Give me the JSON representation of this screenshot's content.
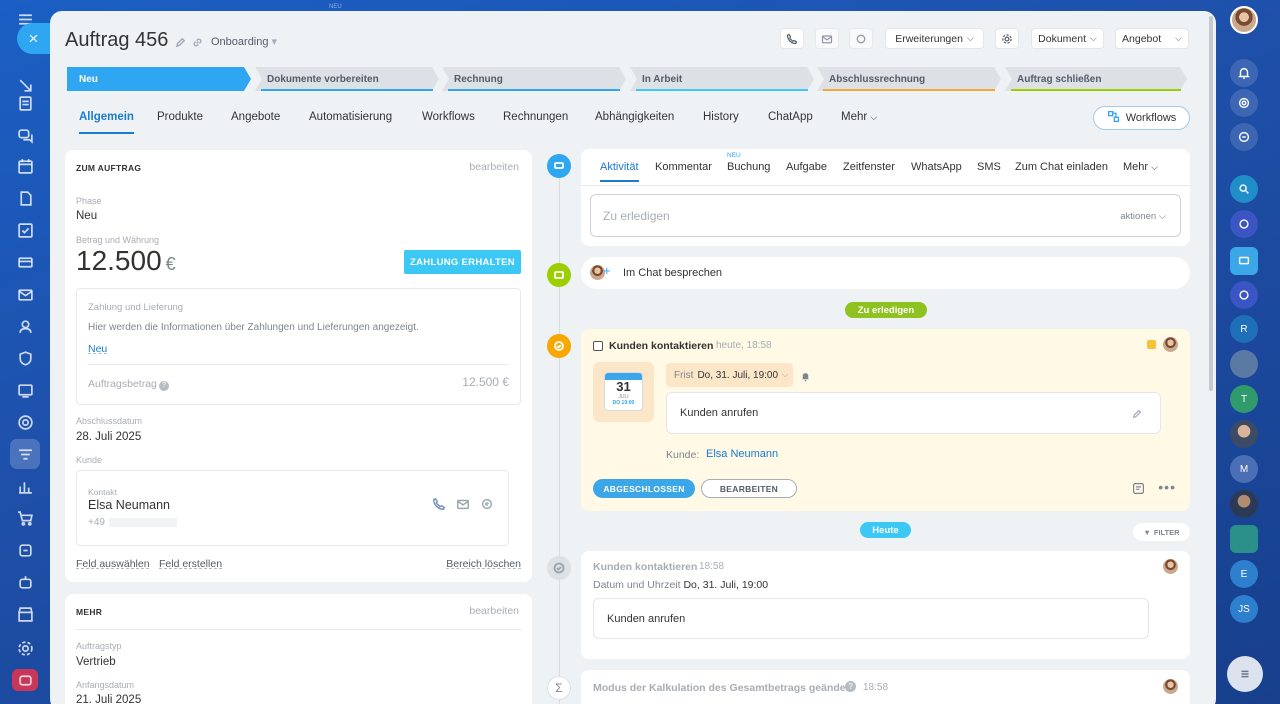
{
  "left_sidebar": {
    "close_label": "×"
  },
  "header": {
    "title": "Auftrag 456",
    "category": "Onboarding",
    "buttons": {
      "extensions": "Erweiterungen",
      "document": "Dokument",
      "offer": "Angebot"
    }
  },
  "topbar_badge": "NEU",
  "stages": [
    {
      "label": "Neu",
      "color": "#2fa6f2"
    },
    {
      "label": "Dokumente vorbereiten",
      "color": "#2fa6f2"
    },
    {
      "label": "Rechnung",
      "color": "#2fa6f2"
    },
    {
      "label": "In Arbeit",
      "color": "#3bc8f5"
    },
    {
      "label": "Abschlussrechnung",
      "color": "#f2a73b"
    },
    {
      "label": "Auftrag schließen",
      "color": "#9dcf00"
    }
  ],
  "tabs": [
    "Allgemein",
    "Produkte",
    "Angebote",
    "Automatisierung",
    "Workflows",
    "Rechnungen",
    "Abhängigkeiten",
    "History",
    "ChatApp",
    "Mehr"
  ],
  "workflows_button": "Workflows",
  "about": {
    "title": "ZUM AUFTRAG",
    "edit": "bearbeiten",
    "phase_label": "Phase",
    "phase_value": "Neu",
    "amount_label": "Betrag und Währung",
    "amount": "12.500",
    "currency": "€",
    "pay_button": "ZAHLUNG ERHALTEN",
    "payment_title": "Zahlung und Lieferung",
    "payment_text": "Hier werden die Informationen über Zahlungen und Lieferungen angezeigt.",
    "payment_new": "Neu",
    "order_amount_label": "Auftragsbetrag",
    "order_amount_value": "12.500 €",
    "close_date_label": "Abschlussdatum",
    "close_date": "28. Juli 2025",
    "client_label": "Kunde",
    "contact_label": "Kontakt",
    "contact_name": "Elsa Neumann",
    "contact_phone": "+49",
    "links": {
      "select": "Feld auswählen",
      "create": "Feld erstellen",
      "delete": "Bereich löschen"
    }
  },
  "more": {
    "title": "MEHR",
    "edit": "bearbeiten",
    "type_label": "Auftragstyp",
    "type_value": "Vertrieb",
    "start_label": "Anfangsdatum",
    "start_value": "21. Juli 2025"
  },
  "activity": {
    "tabs": [
      "Aktivität",
      "Kommentar",
      "Buchung",
      "Aufgabe",
      "Zeitfenster",
      "WhatsApp",
      "SMS",
      "Zum Chat einladen",
      "Mehr"
    ],
    "new_badge": "NEU",
    "placeholder": "Zu erledigen",
    "actions": "aktionen"
  },
  "chat_line": "Im Chat besprechen",
  "todo_badge": "Zu erledigen",
  "task": {
    "title": "Kunden kontaktieren",
    "time": "heute, 18:58",
    "calendar_day": "31",
    "calendar_month": "JULI",
    "calendar_time": "DO 19:00",
    "deadline_label": "Frist",
    "deadline": "Do, 31. Juli, 19:00",
    "text": "Kunden anrufen",
    "client_label": "Kunde:",
    "client": "Elsa Neumann",
    "done": "ABGESCHLOSSEN",
    "edit": "BEARBEITEN"
  },
  "today_badge": "Heute",
  "filter": "FILTER",
  "history1": {
    "title": "Kunden kontaktieren",
    "time": "18:58",
    "date_label": "Datum und Uhrzeit",
    "date": "Do, 31. Juli, 19:00",
    "text": "Kunden anrufen"
  },
  "history2": {
    "title": "Modus der Kalkulation des Gesamtbetrags geändert",
    "time": "18:58"
  },
  "right_sidebar": {
    "initials": [
      "R",
      "T",
      "M",
      "E",
      "JS"
    ]
  }
}
